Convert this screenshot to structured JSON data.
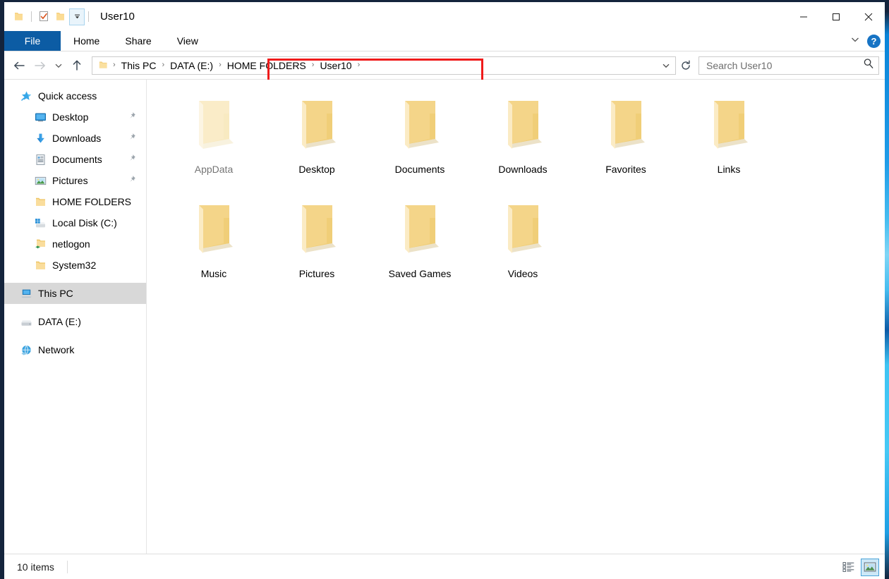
{
  "window": {
    "title": "User10",
    "minimize_label": "Minimize",
    "maximize_label": "Maximize",
    "close_label": "Close"
  },
  "quick_access_toolbar": {
    "items": [
      {
        "name": "folder-icon",
        "label": "Folder"
      },
      {
        "name": "properties-icon",
        "label": "Properties"
      },
      {
        "name": "new-folder-icon",
        "label": "New folder"
      },
      {
        "name": "customize-dropdown-icon",
        "label": "Customize Quick Access Toolbar"
      }
    ]
  },
  "ribbon": {
    "tabs": [
      {
        "label": "File",
        "selected": true
      },
      {
        "label": "Home",
        "selected": false
      },
      {
        "label": "Share",
        "selected": false
      },
      {
        "label": "View",
        "selected": false
      }
    ],
    "expand_label": "Expand the Ribbon",
    "help_label": "?"
  },
  "navbar": {
    "back_label": "Back",
    "forward_label": "Forward",
    "recent_label": "Recent locations",
    "up_label": "Up",
    "refresh_label": "Refresh",
    "address_dropdown_label": "Previous locations",
    "breadcrumbs": [
      {
        "label": "This PC",
        "highlighted": false
      },
      {
        "label": "DATA (E:)",
        "highlighted": true
      },
      {
        "label": "HOME FOLDERS",
        "highlighted": true
      },
      {
        "label": "User10",
        "highlighted": true
      }
    ],
    "separator": "›"
  },
  "search": {
    "placeholder": "Search User10",
    "value": "",
    "icon": "search-icon"
  },
  "annotation": {
    "color": "#ef1b1b",
    "target": "DATA (E:) > HOME FOLDERS > User10 >"
  },
  "sidebar": {
    "items": [
      {
        "label": "Quick access",
        "icon": "star-icon",
        "level": 0,
        "pinned": false,
        "selected": false
      },
      {
        "label": "Desktop",
        "icon": "monitor-icon",
        "level": 1,
        "pinned": true,
        "selected": false
      },
      {
        "label": "Downloads",
        "icon": "download-icon",
        "level": 1,
        "pinned": true,
        "selected": false
      },
      {
        "label": "Documents",
        "icon": "document-icon",
        "level": 1,
        "pinned": true,
        "selected": false
      },
      {
        "label": "Pictures",
        "icon": "picture-icon",
        "level": 1,
        "pinned": true,
        "selected": false
      },
      {
        "label": "HOME FOLDERS",
        "icon": "folder-icon",
        "level": 1,
        "pinned": false,
        "selected": false
      },
      {
        "label": "Local Disk (C:)",
        "icon": "harddisk-windows-icon",
        "level": 1,
        "pinned": false,
        "selected": false
      },
      {
        "label": "netlogon",
        "icon": "shared-folder-icon",
        "level": 1,
        "pinned": false,
        "selected": false
      },
      {
        "label": "System32",
        "icon": "folder-icon",
        "level": 1,
        "pinned": false,
        "selected": false
      },
      {
        "label": "This PC",
        "icon": "this-pc-icon",
        "level": 0,
        "pinned": false,
        "selected": true,
        "gap_before": true
      },
      {
        "label": "DATA (E:)",
        "icon": "drive-icon",
        "level": 0,
        "pinned": false,
        "selected": false,
        "gap_before": true
      },
      {
        "label": "Network",
        "icon": "network-icon",
        "level": 0,
        "pinned": false,
        "selected": false,
        "gap_before": true
      }
    ]
  },
  "files": [
    {
      "name": "AppData",
      "type": "folder",
      "hidden": true
    },
    {
      "name": "Desktop",
      "type": "folder",
      "hidden": false
    },
    {
      "name": "Documents",
      "type": "folder",
      "hidden": false
    },
    {
      "name": "Downloads",
      "type": "folder",
      "hidden": false
    },
    {
      "name": "Favorites",
      "type": "folder",
      "hidden": false
    },
    {
      "name": "Links",
      "type": "folder",
      "hidden": false
    },
    {
      "name": "Music",
      "type": "folder",
      "hidden": false
    },
    {
      "name": "Pictures",
      "type": "folder",
      "hidden": false
    },
    {
      "name": "Saved Games",
      "type": "folder",
      "hidden": false
    },
    {
      "name": "Videos",
      "type": "folder",
      "hidden": false
    }
  ],
  "statusbar": {
    "item_count": "10 items",
    "views": [
      {
        "name": "details-view-button",
        "label": "Details view",
        "active": false
      },
      {
        "name": "large-icons-view-button",
        "label": "Large icons view",
        "active": true
      }
    ]
  },
  "colors": {
    "file_tab": "#0c5ca4",
    "selection": "#d8d8d8",
    "annotation": "#ef1b1b",
    "folder_yellow": "#f7d47d",
    "accent_blue": "#1673c4"
  }
}
